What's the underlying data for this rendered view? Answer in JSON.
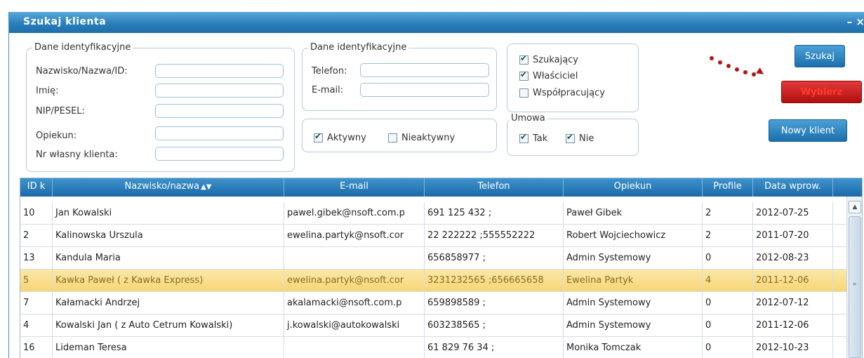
{
  "window": {
    "title": "Szukaj klienta",
    "controls": "– ×"
  },
  "ident1": {
    "legend": "Dane identyfikacyjne",
    "fields": [
      {
        "label": "Nazwisko/Nazwa/ID:",
        "value": ""
      },
      {
        "label": "Imię:",
        "value": ""
      },
      {
        "label": "NIP/PESEL:",
        "value": ""
      },
      {
        "label": "Opiekun:",
        "value": ""
      },
      {
        "label": "Nr własny klienta:",
        "value": ""
      }
    ]
  },
  "ident2": {
    "legend": "Dane identyfikacyjne",
    "fields": [
      {
        "label": "Telefon:",
        "value": ""
      },
      {
        "label": "E-mail:",
        "value": ""
      }
    ]
  },
  "roles": {
    "options": [
      {
        "label": "Szukający",
        "checked": true
      },
      {
        "label": "Właściciel",
        "checked": true
      },
      {
        "label": "Współpracujący",
        "checked": false
      }
    ]
  },
  "status": {
    "options": [
      {
        "label": "Aktywny",
        "checked": true
      },
      {
        "label": "Nieaktywny",
        "checked": false
      }
    ]
  },
  "umowa": {
    "legend": "Umowa",
    "options": [
      {
        "label": "Tak",
        "checked": true
      },
      {
        "label": "Nie",
        "checked": true
      }
    ]
  },
  "buttons": {
    "search": "Szukaj",
    "select": "Wybierz",
    "new_client": "Nowy klient"
  },
  "table": {
    "columns": [
      "ID k",
      "Nazwisko/nazwa",
      "E-mail",
      "Telefon",
      "Opiekun",
      "Profile",
      "Data wprow."
    ],
    "sort_icon": "▲▼",
    "rows": [
      {
        "id": "10",
        "name": "Jan Kowalski",
        "email": "pawel.gibek@nsoft.com.p",
        "phone": "691 125 432 ;",
        "owner": "Paweł Gibek",
        "profile": "2",
        "date": "2012-07-25",
        "selected": false
      },
      {
        "id": "2",
        "name": "Kalinowska Urszula",
        "email": "ewelina.partyk@nsoft.cor",
        "phone": "22 222222 ;555552222",
        "owner": "Robert Wojciechowicz",
        "profile": "2",
        "date": "2011-07-20",
        "selected": false
      },
      {
        "id": "13",
        "name": "Kandula Maria",
        "email": "",
        "phone": "656858977 ;",
        "owner": "Admin Systemowy",
        "profile": "0",
        "date": "2012-08-23",
        "selected": false
      },
      {
        "id": "5",
        "name": "Kawka Paweł ( z Kawka Express)",
        "email": "ewelina.partyk@nsoft.cor",
        "phone": "3231232565 ;656665658",
        "owner": "Ewelina Partyk",
        "profile": "4",
        "date": "2011-12-06",
        "selected": true
      },
      {
        "id": "7",
        "name": "Kałamacki Andrzej",
        "email": "akalamacki@nsoft.com.p",
        "phone": "659898589 ;",
        "owner": "Admin Systemowy",
        "profile": "0",
        "date": "2012-07-12",
        "selected": false
      },
      {
        "id": "4",
        "name": "Kowalski Jan ( z Auto Cetrum Kowalski)",
        "email": "j.kowalski@autokowalski",
        "phone": "603238565 ;",
        "owner": "Admin Systemowy",
        "profile": "0",
        "date": "2011-12-06",
        "selected": false
      },
      {
        "id": "16",
        "name": "Lideman Teresa",
        "email": "",
        "phone": "61 829 76 34 ;",
        "owner": "Monika Tomczak",
        "profile": "0",
        "date": "2012-10-23",
        "selected": false
      }
    ]
  },
  "colors": {
    "accent": "#1f6ea8",
    "selected_row": "#f7d676",
    "highlight_button": "#c01515"
  }
}
